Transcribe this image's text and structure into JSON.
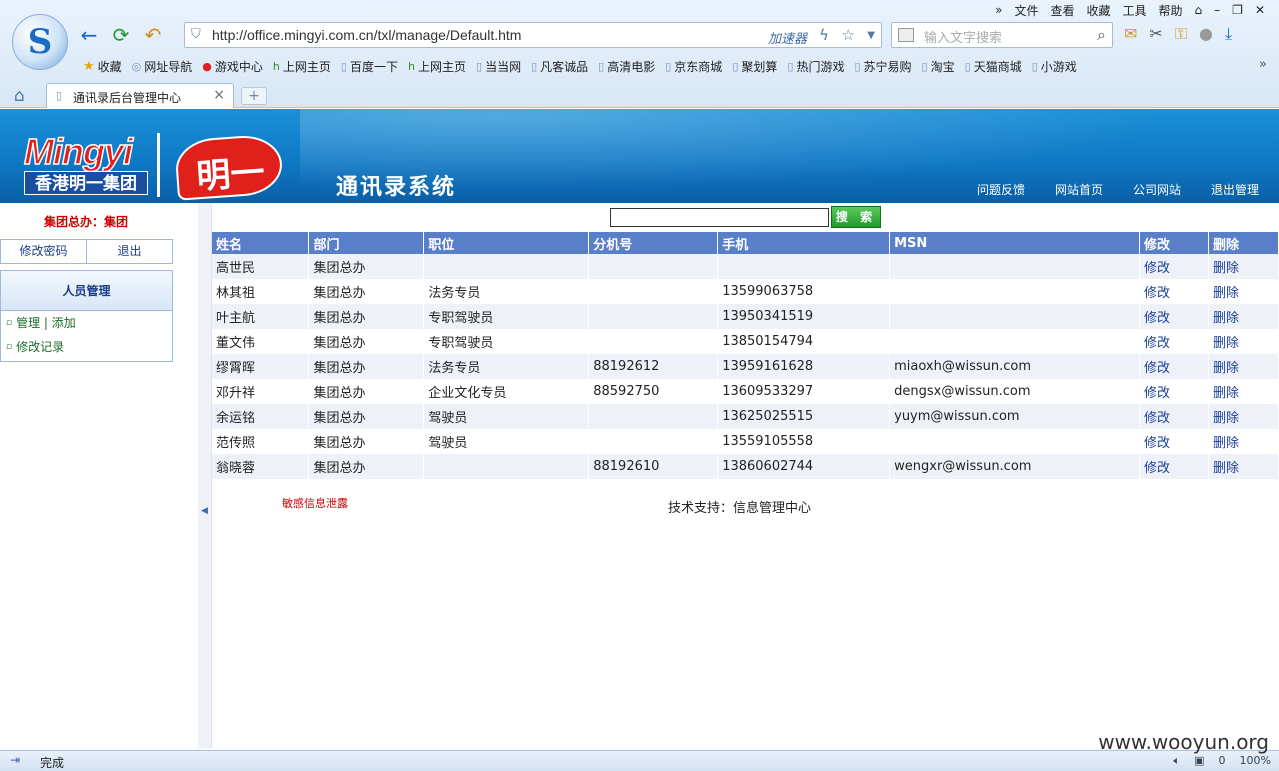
{
  "browser": {
    "menu": [
      "»",
      "文件",
      "查看",
      "收藏",
      "工具",
      "帮助"
    ],
    "url": "http://office.mingyi.com.cn/txl/manage/Default.htm",
    "accelerator": "加速器",
    "search_placeholder": "输入文字搜索",
    "bookmarks": [
      {
        "label": "收藏",
        "icon": "star-icon"
      },
      {
        "label": "网址导航",
        "icon": "globe-icon"
      },
      {
        "label": "游戏中心",
        "icon": "game-icon"
      },
      {
        "label": "上网主页",
        "icon": "hao-icon"
      },
      {
        "label": "百度一下",
        "icon": "page-icon"
      },
      {
        "label": "上网主页",
        "icon": "hao-icon"
      },
      {
        "label": "当当网",
        "icon": "page-icon"
      },
      {
        "label": "凡客诚品",
        "icon": "page-icon"
      },
      {
        "label": "高清电影",
        "icon": "page-icon"
      },
      {
        "label": "京东商城",
        "icon": "page-icon"
      },
      {
        "label": "聚划算",
        "icon": "page-icon"
      },
      {
        "label": "热门游戏",
        "icon": "page-icon"
      },
      {
        "label": "苏宁易购",
        "icon": "page-icon"
      },
      {
        "label": "淘宝",
        "icon": "page-icon"
      },
      {
        "label": "天猫商城",
        "icon": "page-icon"
      },
      {
        "label": "小游戏",
        "icon": "page-icon"
      }
    ],
    "tab_title": "通讯录后台管理中心",
    "status_text": "完成",
    "status_right": [
      "0",
      "100%"
    ],
    "watermark": "www.wooyun.org"
  },
  "header": {
    "brand_en": "Mingyi",
    "brand_cn": "香港明一集团",
    "brand_mark": "明一",
    "system_title": "通讯录系统",
    "links": [
      "问题反馈",
      "网站首页",
      "公司网站",
      "退出管理"
    ]
  },
  "sidebar": {
    "title": "集团总办：集团",
    "buttons": [
      "修改密码",
      "退出"
    ],
    "panel_title": "人员管理",
    "items": [
      "管理 | 添加",
      "修改记录"
    ]
  },
  "main": {
    "search_button": "搜 索",
    "columns": [
      "姓名",
      "部门",
      "职位",
      "分机号",
      "手机",
      "MSN",
      "修改",
      "删除"
    ],
    "rows": [
      [
        "高世民",
        "集团总办",
        "",
        "",
        "",
        "",
        "修改",
        "删除"
      ],
      [
        "林其祖",
        "集团总办",
        "法务专员",
        "",
        "13599063758",
        "",
        "修改",
        "删除"
      ],
      [
        "叶主航",
        "集团总办",
        "专职驾驶员",
        "",
        "13950341519",
        "",
        "修改",
        "删除"
      ],
      [
        "董文伟",
        "集团总办",
        "专职驾驶员",
        "",
        "13850154794",
        "",
        "修改",
        "删除"
      ],
      [
        "缪霄晖",
        "集团总办",
        "法务专员",
        "88192612",
        "13959161628",
        "miaoxh@wissun.com",
        "修改",
        "删除"
      ],
      [
        "邓升祥",
        "集团总办",
        "企业文化专员",
        "88592750",
        "13609533297",
        "dengsx@wissun.com",
        "修改",
        "删除"
      ],
      [
        "余运铭",
        "集团总办",
        "驾驶员",
        "",
        "13625025515",
        "yuym@wissun.com",
        "修改",
        "删除"
      ],
      [
        "范传照",
        "集团总办",
        "驾驶员",
        "",
        "13559105558",
        "",
        "修改",
        "删除"
      ],
      [
        "翁晓蓉",
        "集团总办",
        "",
        "88192610",
        "13860602744",
        "wengxr@wissun.com",
        "修改",
        "删除"
      ]
    ],
    "leak_note": "敏感信息泄露",
    "support": "技术支持：信息管理中心"
  }
}
